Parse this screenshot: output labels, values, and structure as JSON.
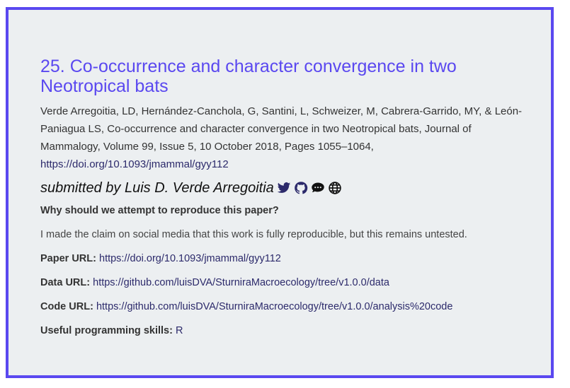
{
  "entry": {
    "title": "25. Co-occurrence and character convergence in two Neotropical bats",
    "citation": "Verde Arregoitia, LD, Hernández-Canchola, G, Santini, L, Schweizer, M, Cabrera-Garrido, MY, & León-Paniagua LS, Co-occurrence and character convergence in two Neotropical bats, Journal of Mammalogy, Volume 99, Issue 5, 10 October 2018, Pages 1055–1064,",
    "citation_doi": "https://doi.org/10.1093/jmammal/gyy112",
    "submitted_by": "submitted by Luis D. Verde Arregoitia",
    "question": "Why should we attempt to reproduce this paper?",
    "reason": "I made the claim on social media that this work is fully reproducible, but this remains untested.",
    "paper_url_label": "Paper URL:",
    "paper_url": "https://doi.org/10.1093/jmammal/gyy112",
    "data_url_label": "Data URL:",
    "data_url": "https://github.com/luisDVA/SturniraMacroecology/tree/v1.0.0/data",
    "code_url_label": "Code URL:",
    "code_url": "https://github.com/luisDVA/SturniraMacroecology/tree/v1.0.0/analysis%20code",
    "skills_label": "Useful programming skills:",
    "skills": "R"
  },
  "icons": [
    "twitter-icon",
    "github-icon",
    "comment-icon",
    "globe-icon"
  ],
  "colors": {
    "accent": "#5a48f0",
    "link": "#2c2a6b",
    "background": "#eceff1"
  }
}
